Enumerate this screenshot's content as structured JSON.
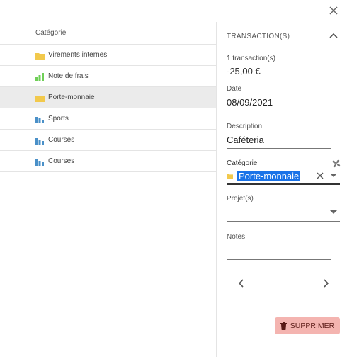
{
  "list": {
    "column_header": "Catégorie",
    "rows": [
      {
        "label": "Virements internes",
        "icon": "folder-icon",
        "color": "#f2c94c"
      },
      {
        "label": "Note de frais",
        "icon": "bar-chart-icon",
        "color": "#6fcf57"
      },
      {
        "label": "Porte-monnaie",
        "icon": "folder-icon",
        "color": "#f2c94c",
        "selected": true
      },
      {
        "label": "Sports",
        "icon": "bar-chart-icon",
        "color": "#4a90c8"
      },
      {
        "label": "Courses",
        "icon": "bar-chart-icon",
        "color": "#4a90c8"
      },
      {
        "label": "Courses",
        "icon": "bar-chart-icon",
        "color": "#4a90c8"
      }
    ]
  },
  "panel": {
    "title": "TRANSACTION(S)",
    "count": "1 transaction(s)",
    "amount": "-25,00 €",
    "date_label": "Date",
    "date_value": "08/09/2021",
    "description_label": "Description",
    "description_value": "Caféteria",
    "category_label": "Catégorie",
    "category_value": "Porte-monnaie",
    "projects_label": "Projet(s)",
    "notes_label": "Notes",
    "delete_label": "SUPPRIMER",
    "delete_color": "#f4b4b0"
  }
}
